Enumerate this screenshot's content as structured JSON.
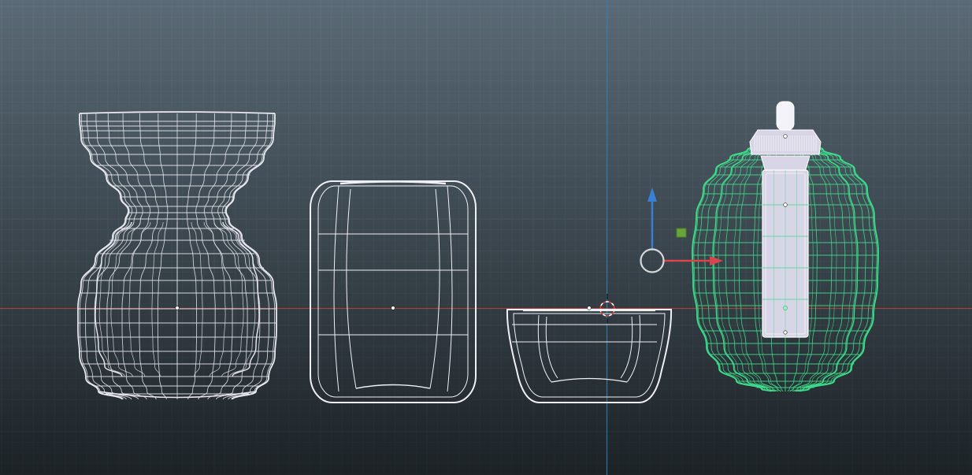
{
  "viewport": {
    "view": "front-orthographic",
    "background_top": "#5a6a76",
    "background_bottom": "#1c2226",
    "grid_color": "#7c8c98",
    "x_axis_color": "#b0463c",
    "z_axis_color": "#2f7fb3"
  },
  "objects": [
    {
      "name": "hourglass-vase-wireframe",
      "selected": false,
      "wire_color": "#e8e8ee"
    },
    {
      "name": "barrel-jar-wireframe",
      "selected": false,
      "wire_color": "#f0f0f4"
    },
    {
      "name": "bowl-wireframe",
      "selected": false,
      "wire_color": "#f0f0f4"
    },
    {
      "name": "egg-bottle-wireframe",
      "selected": true,
      "wire_color": "#3ddc8a",
      "inner_part_color": "#d8d6e6"
    }
  ],
  "gizmo": {
    "axes": [
      "x-arrow-icon",
      "z-arrow-icon",
      "rotate-circle-icon",
      "plane-handle-icon"
    ],
    "x_color": "#d9454a",
    "z_color": "#3a7fd6",
    "plane_color": "#6aa53a",
    "circle_color": "#d8d8d8"
  },
  "cursor_3d": {
    "icon": "3d-cursor-icon",
    "color_a": "#e04040",
    "color_b": "#ffffff"
  }
}
